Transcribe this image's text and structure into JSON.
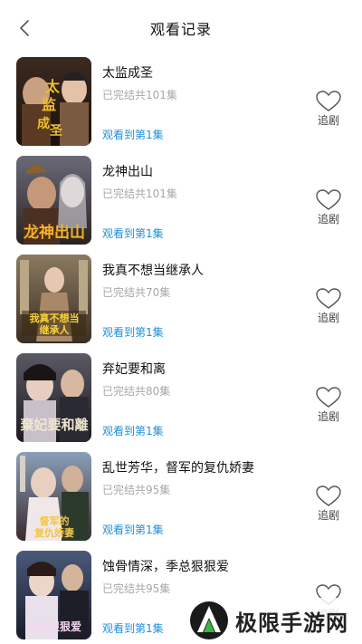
{
  "header": {
    "title": "观看记录",
    "back_icon": "chevron-left-icon"
  },
  "items": [
    {
      "title": "太监成圣",
      "status": "已完结共101集",
      "progress": "观看到第1集",
      "follow_label": "追剧",
      "poster_text": "太监成圣"
    },
    {
      "title": "龙神出山",
      "status": "已完结共101集",
      "progress": "观看到第1集",
      "follow_label": "追剧",
      "poster_text": "龙神出山"
    },
    {
      "title": "我真不想当继承人",
      "status": "已完结共70集",
      "progress": "观看到第1集",
      "follow_label": "追剧",
      "poster_text": "我真不想当继承人"
    },
    {
      "title": "弃妃要和离",
      "status": "已完结共80集",
      "progress": "观看到第1集",
      "follow_label": "追剧",
      "poster_text": "棄妃要和離"
    },
    {
      "title": "乱世芳华，督军的复仇娇妻",
      "status": "已完结共95集",
      "progress": "观看到第1集",
      "follow_label": "追剧",
      "poster_text": "督军的复仇娇妻"
    },
    {
      "title": "蚀骨情深，季总狠狠爱",
      "status": "已完结共95集",
      "progress": "观看到第1集",
      "follow_label": "追剧",
      "poster_text": "季总狠狠爱"
    }
  ],
  "watermark": {
    "text": "极限手游网"
  },
  "colors": {
    "accent": "#1e90d8",
    "muted": "#a8a8a8",
    "text": "#111111"
  }
}
